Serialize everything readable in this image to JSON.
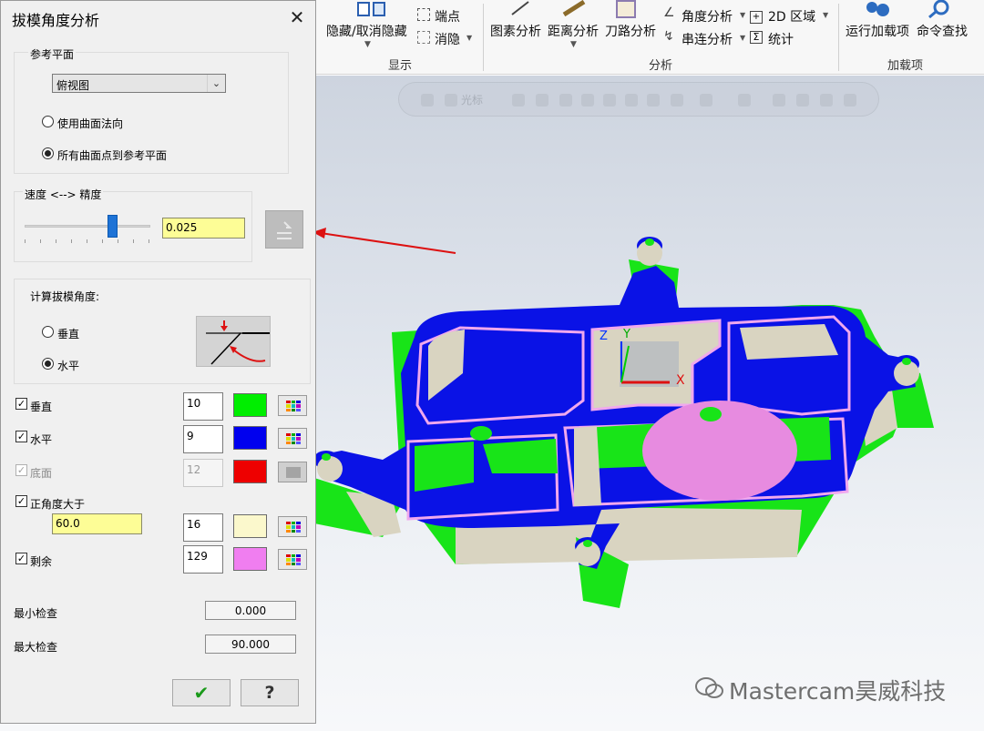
{
  "ribbon": {
    "hide_label": "隐藏/取消隐藏",
    "endpoint_label": "端点",
    "eliminate_label": "消隐",
    "display_group": "显示",
    "entity_analysis": "图素分析",
    "distance_analysis": "距离分析",
    "toolpath_label": "刀路分析",
    "angle_analysis": "角度分析",
    "chain_analysis": "串连分析",
    "area_2d": "2D 区域",
    "statistics": "统计",
    "analysis_group": "分析",
    "run_addin": "运行加载项",
    "command_search": "命令查找",
    "addin_group": "加载项"
  },
  "viewport": {
    "toolbar_text": "光标",
    "watermark": "Mastercam昊威科技",
    "axis_x": "X",
    "axis_y": "Y",
    "axis_z": "Z"
  },
  "dialog": {
    "title": "拔模角度分析",
    "close": "✕",
    "ref_plane_group": "参考平面",
    "plane_value": "俯视图",
    "radio_surface_normal": "使用曲面法向",
    "radio_all_points": "所有曲面点到参考平面",
    "speed_label": "速度 <--> 精度",
    "speed_value": "0.025",
    "speed_level": 0.72,
    "compute_group": "计算拔模角度:",
    "radio_vertical": "垂直",
    "radio_horizontal": "水平",
    "rows": {
      "vertical": {
        "label": "垂直",
        "count": "10",
        "color": "#00ee00"
      },
      "horizontal": {
        "label": "水平",
        "count": "9",
        "color": "#0000ee"
      },
      "bottom": {
        "label": "底面",
        "count": "12",
        "color": "#ee0000"
      },
      "positive": {
        "label": "正角度大于",
        "angle": "60.0",
        "count": "16",
        "color": "#fbf8cc"
      },
      "remainder": {
        "label": "剩余",
        "count": "129",
        "color": "#f07ef0"
      }
    },
    "min_check_label": "最小检查",
    "min_check_value": "0.000",
    "max_check_label": "最大检查",
    "max_check_value": "90.000",
    "ok_glyph": "✔",
    "help_glyph": "?"
  },
  "colors": {
    "model_blue": "#0a12e6",
    "model_green": "#18e418",
    "model_wall": "#d8d3c0",
    "model_pink": "#e78be0",
    "arrow_red": "#dd1111"
  }
}
